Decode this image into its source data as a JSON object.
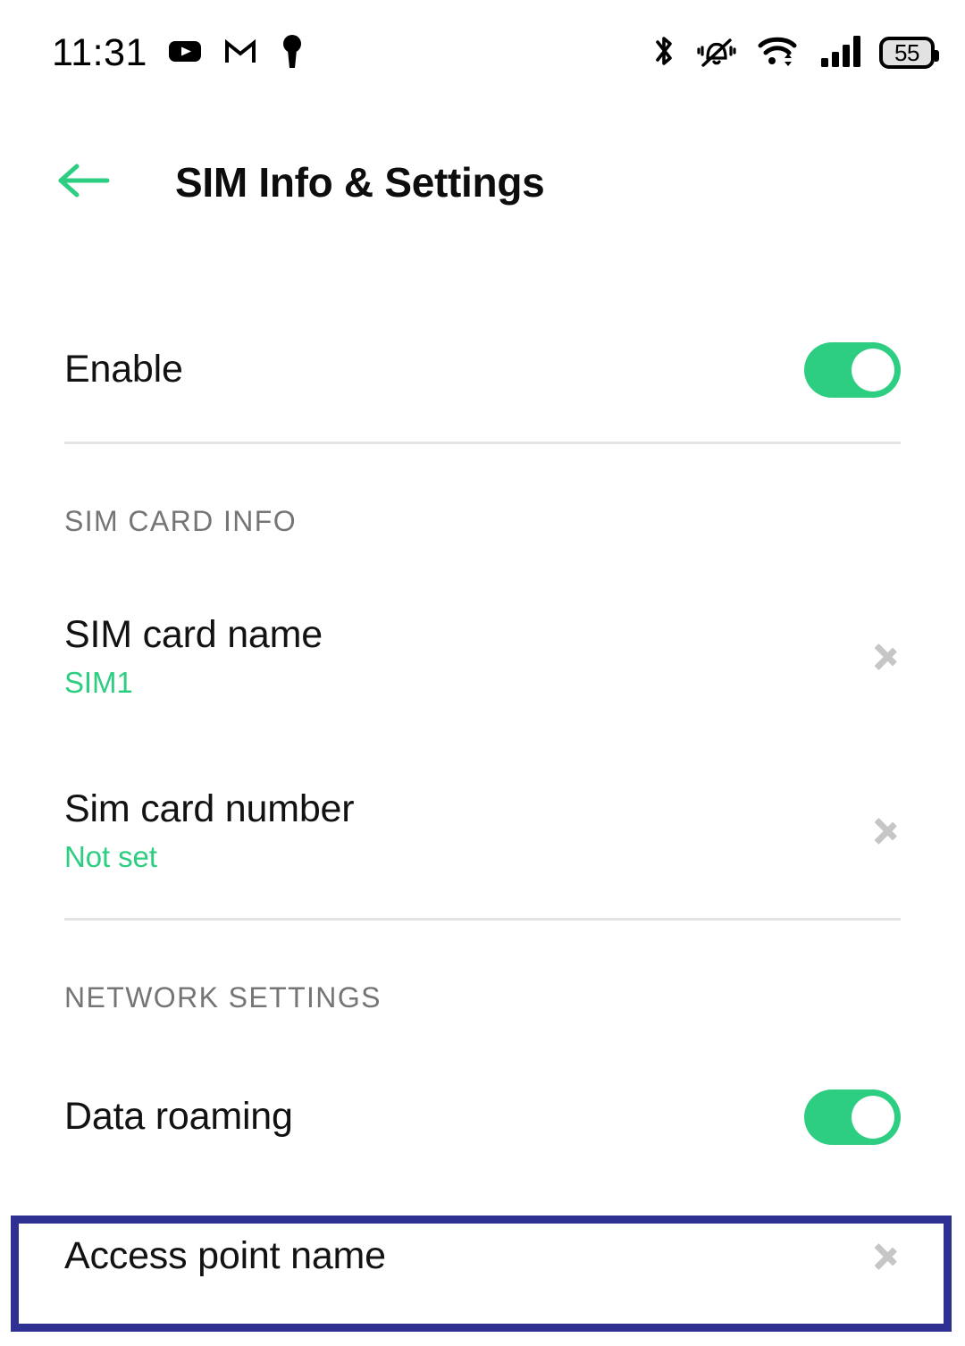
{
  "status_bar": {
    "time": "11:31",
    "left_icons": [
      {
        "name": "youtube-icon",
        "label": "YouTube"
      },
      {
        "name": "gmail-icon",
        "label": "Gmail"
      },
      {
        "name": "keyhole-icon",
        "label": "Keyhole"
      }
    ],
    "right_icons": [
      {
        "name": "bluetooth-icon",
        "label": "Bluetooth"
      },
      {
        "name": "vibrate-icon",
        "label": "Vibrate"
      },
      {
        "name": "wifi-icon",
        "label": "Wi-Fi"
      },
      {
        "name": "signal-icon",
        "label": "Cellular signal"
      }
    ],
    "battery_level": "55"
  },
  "app_bar": {
    "back_icon": "arrow-left-icon",
    "title": "SIM Info & Settings"
  },
  "enable_row": {
    "label": "Enable",
    "toggle_state": "on"
  },
  "sections": [
    {
      "header": "SIM CARD INFO",
      "rows": [
        {
          "title": "SIM card name",
          "value": "SIM1"
        },
        {
          "title": "Sim card number",
          "value": "Not set"
        }
      ]
    },
    {
      "header": "NETWORK SETTINGS",
      "rows": [
        {
          "title": "Data roaming",
          "toggle_state": "on"
        },
        {
          "title": "Access point name"
        }
      ]
    }
  ],
  "colors": {
    "accent_green": "#2ECE82",
    "highlight_border": "#2E3192",
    "section_header": "#757575",
    "chevron": "#C6C6C6",
    "divider": "#E4E4E4"
  }
}
